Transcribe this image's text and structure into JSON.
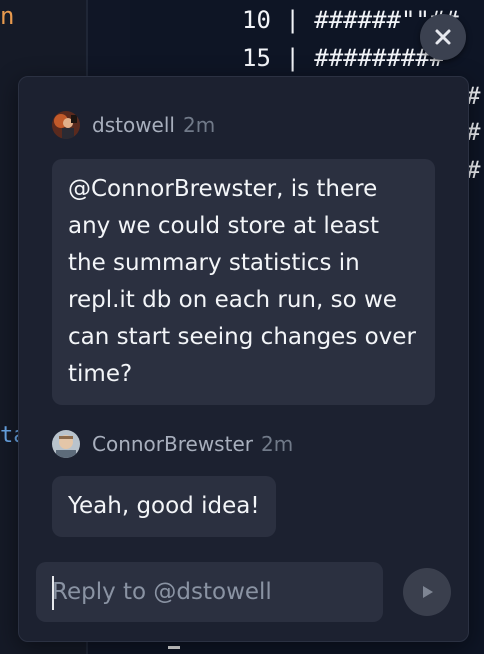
{
  "editor": {
    "left_fragment_top": "n",
    "left_fragment_bottom": "ta",
    "code_lines": [
      "10 | ######\"\"##",
      "15 | #########"
    ],
    "hash_glyph": "#"
  },
  "thread": {
    "messages": [
      {
        "author": "dstowell",
        "time": "2m",
        "text": "@ConnorBrewster, is there any we could store at least the summary statistics in repl.it db on each run, so we can start seeing changes over time?"
      },
      {
        "author": "ConnorBrewster",
        "time": "2m",
        "text": "Yeah, good idea!"
      }
    ],
    "reply": {
      "placeholder": "Reply to @dstowell",
      "value": ""
    }
  },
  "icons": {
    "close": "close-icon",
    "send": "send-icon"
  },
  "colors": {
    "background": "#0e1525",
    "panel": "#1c2130",
    "bubble": "#2b3040",
    "author_text": "#a8afbd",
    "time_text": "#717a89"
  }
}
